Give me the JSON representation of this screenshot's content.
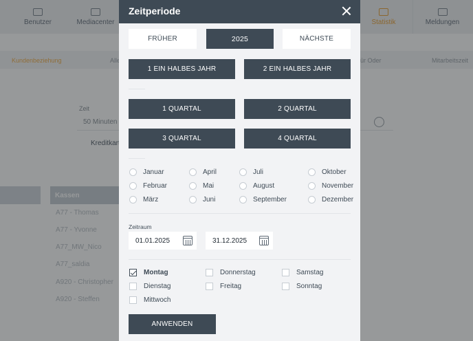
{
  "background": {
    "nav": [
      "Benutzer",
      "Mediacenter",
      "Statistik",
      "Meldungen"
    ],
    "subnav": [
      "Kundenbeziehung",
      "Alle",
      "ür Oder",
      "Mitarbeitszeit"
    ],
    "field_label": "Zeit",
    "field_value": "50 Minuten",
    "kredit_label": "Kreditkarte",
    "kassen_label": "Kassen",
    "kassen_list": [
      "A77 - Thomas",
      "A77 - Yvonne",
      "A77_MW_Nico",
      "A77_saldia",
      "A920 - Christopher",
      "A920 - Steffen"
    ]
  },
  "modal": {
    "title": "Zeitperiode",
    "nav": {
      "prev": "FRÜHER",
      "year": "2025",
      "next": "NÄCHSTE"
    },
    "halves": [
      "1 EIN HALBES JAHR",
      "2 EIN HALBES JAHR"
    ],
    "quarters": [
      "1 QUARTAL",
      "2 QUARTAL",
      "3 QUARTAL",
      "4 QUARTAL"
    ],
    "months": [
      "Januar",
      "Februar",
      "März",
      "April",
      "Mai",
      "Juni",
      "Juli",
      "August",
      "September",
      "Oktober",
      "November",
      "Dezember"
    ],
    "range": {
      "label": "Zeitraum",
      "from": "01.01.2025",
      "to": "31.12.2025"
    },
    "weekdays": [
      {
        "label": "Montag",
        "checked": true
      },
      {
        "label": "Dienstag",
        "checked": false
      },
      {
        "label": "Mittwoch",
        "checked": false
      },
      {
        "label": "Donnerstag",
        "checked": false
      },
      {
        "label": "Freitag",
        "checked": false
      },
      {
        "label": "Samstag",
        "checked": false
      },
      {
        "label": "Sonntag",
        "checked": false
      }
    ],
    "apply": "ANWENDEN"
  },
  "icons": {
    "close": "close-icon",
    "calendar": "calendar-icon",
    "checkbox_checked": "check-icon"
  },
  "colors": {
    "primary": "#3e4a55",
    "accent": "#e9a23b",
    "panel": "#f2f3f5"
  }
}
